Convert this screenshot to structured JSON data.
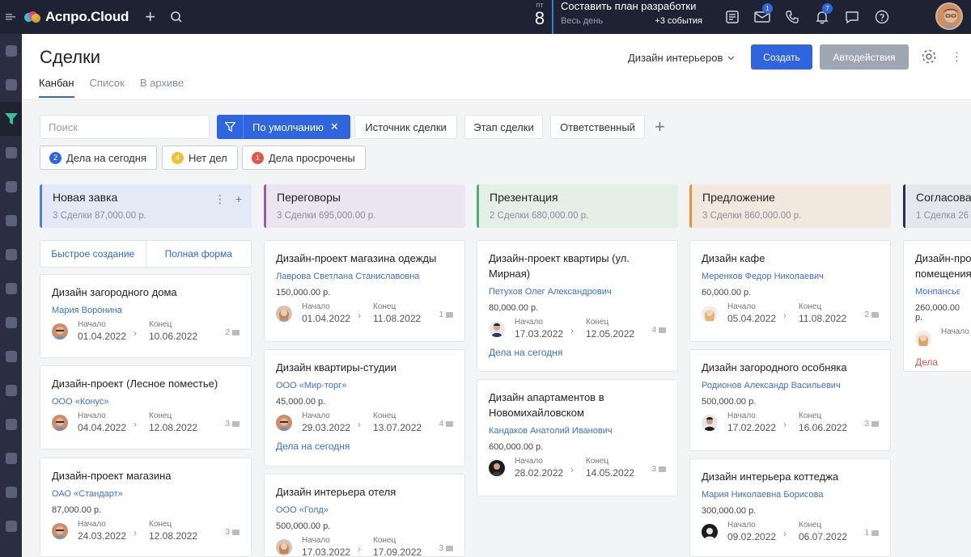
{
  "topbar": {
    "app_name": "Аспро.Cloud",
    "date": {
      "weekday": "пт",
      "day": "8"
    },
    "task": {
      "title": "Составить план разработки",
      "subtitle": "Весь день",
      "events": "+3 события"
    },
    "badges": {
      "mail": "1",
      "notifications": "7"
    }
  },
  "header": {
    "title": "Сделки",
    "tabs": [
      "Канбан",
      "Список",
      "В архиве"
    ],
    "pipeline": "Дизайн интерьеров",
    "create_label": "Создать",
    "auto_label": "Автодействия"
  },
  "filters": {
    "search_placeholder": "Поиск",
    "default_filter": "По умолчанию",
    "chips": [
      "Источник сделки",
      "Этап сделки",
      "Ответственный"
    ],
    "quick": [
      {
        "count": "2",
        "label": "Дела на сегодня",
        "color": "#2f66e0"
      },
      {
        "count": "4",
        "label": "Нет дел",
        "color": "#f2c12e"
      },
      {
        "count": "1",
        "label": "Дела просрочены",
        "color": "#e5534b"
      }
    ]
  },
  "quick_create": {
    "fast": "Быстрое создание",
    "full": "Полная форма"
  },
  "labels": {
    "start": "Начало",
    "end": "Конец",
    "today_tasks": "Дела на сегодня",
    "overdue_tasks": "Дела просроч"
  },
  "columns": [
    {
      "name": "Новая завка",
      "meta": "3 Сделки   87,000.00 р.",
      "color": "#4f7fd8",
      "bg": "#e3eaf6",
      "cards": [
        {
          "title": "Дизайн загородного дома",
          "client": "Мария Воронина",
          "start": "01.04.2022",
          "end": "10.06.2022",
          "comments": "2"
        },
        {
          "title": "Дизайн-проект (Лесное поместье)",
          "client": "ООО «Конус»",
          "start": "04.04.2022",
          "end": "12.08.2022",
          "comments": "3"
        },
        {
          "title": "Дизайн-проект магазина",
          "client": "ОАО «Стандарт»",
          "sum": "87,000.00 р.",
          "start": "24.03.2022",
          "end": "12.08.2022",
          "comments": "3"
        }
      ]
    },
    {
      "name": "Переговоры",
      "meta": "3 Сделки   695,000.00 р.",
      "color": "#9b59b6",
      "bg": "#ebe5f0",
      "cards": [
        {
          "title": "Дизайн-проект магазина одежды",
          "client": "Лаврова Светлана Станиславовна",
          "sum": "150,000.00 р.",
          "start": "01.04.2022",
          "end": "11.08.2022",
          "comments": "1"
        },
        {
          "title": "Дизайн квартиры-студии",
          "client": "ООО «Мир-торг»",
          "sum": "45,000.00 р.",
          "start": "29.03.2022",
          "end": "13.07.2022",
          "comments": "4"
        },
        {
          "title": "Дизайн интерьера отеля",
          "client": "ООО «Голд»",
          "sum": "500,000.00 р.",
          "start": "17.03.2022",
          "end": "17.09.2022",
          "comments": "3"
        }
      ]
    },
    {
      "name": "Презентация",
      "meta": "2 Сделки   680,000.00 р.",
      "color": "#4caf78",
      "bg": "#e4efe8",
      "cards": [
        {
          "title": "Дизайн-проект квартиры (ул. Мирная)",
          "client": "Петухов Олег Александрович",
          "sum": "80,000.00 р.",
          "start": "17.03.2022",
          "end": "12.05.2022",
          "comments": "4"
        },
        {
          "title": "Дизайн апартаментов в Новомихайловском",
          "client": "Кандаков Анатолий Иванович",
          "sum": "600,000.00 р.",
          "start": "28.02.2022",
          "end": "14.05.2022",
          "comments": "3"
        }
      ]
    },
    {
      "name": "Предложение",
      "meta": "3 Сделки   860,000.00 р.",
      "color": "#e8913a",
      "bg": "#f2e9de",
      "cards": [
        {
          "title": "Дизайн кафе",
          "client": "Меренков Федор Николаевич",
          "sum": "60,000.00 р.",
          "start": "05.04.2022",
          "end": "11.08.2022",
          "comments": "2"
        },
        {
          "title": "Дизайн загородного особняка",
          "client": "Родионов Александр Васильевич",
          "sum": "500,000.00 р.",
          "start": "17.02.2022",
          "end": "16.06.2022",
          "comments": "3"
        },
        {
          "title": "Дизайн интерьера коттеджа",
          "client": "Мария Николаевна Борисова",
          "sum": "300,000.00 р.",
          "start": "09.02.2022",
          "end": "06.07.2022",
          "comments": "1"
        }
      ]
    },
    {
      "name": "Согласова",
      "meta": "1 Сделка   26",
      "color": "#2d2f4a",
      "bg": "#e6e7ec",
      "cards": [
        {
          "title": "Дизайн-про помещения",
          "client": "Монпансье",
          "sum": "260,000.00 р.",
          "start": "",
          "end": "",
          "comments": ""
        }
      ]
    }
  ]
}
